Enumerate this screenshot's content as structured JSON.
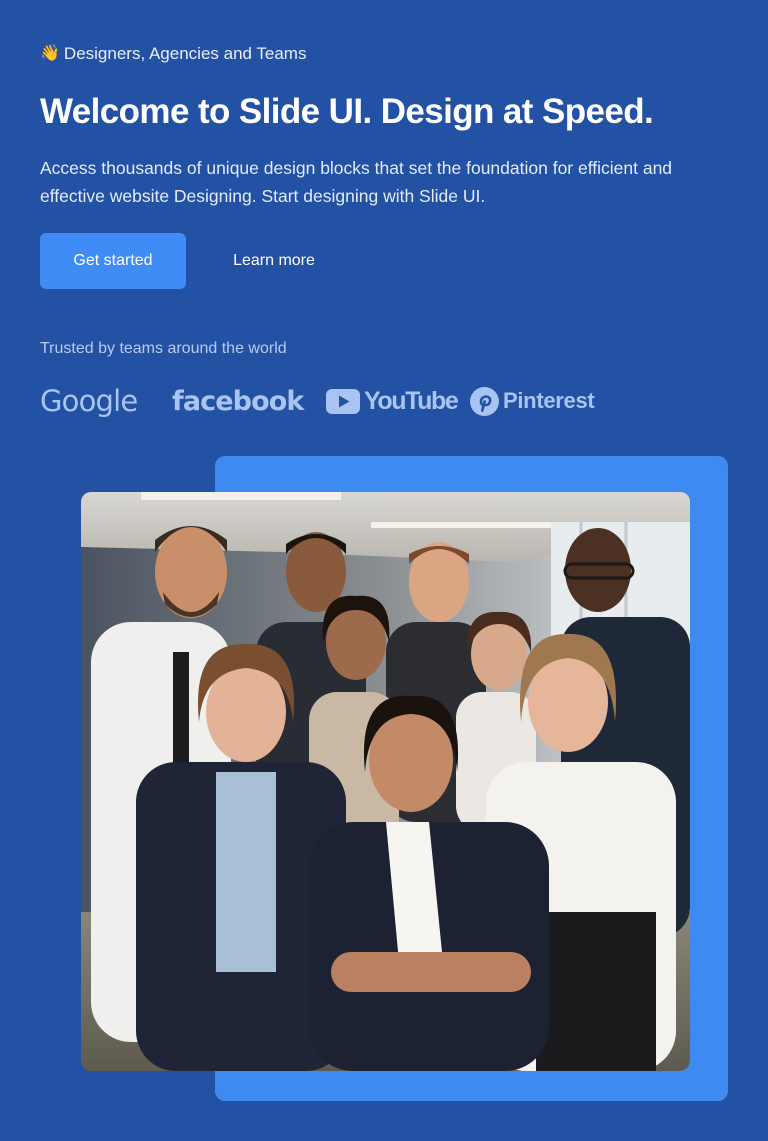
{
  "hero": {
    "eyebrow": {
      "emoji": "👋",
      "text": "Designers, Agencies and Teams"
    },
    "headline": "Welcome to Slide UI. Design at Speed.",
    "subtext": "Access thousands of unique design blocks that set the foundation for efficient and effective website Designing. Start designing with Slide UI.",
    "primary_button": "Get started",
    "secondary_button": "Learn more"
  },
  "trusted": {
    "label": "Trusted by teams around the world",
    "logos": [
      {
        "name": "Google",
        "icon": "google-logo"
      },
      {
        "name": "facebook",
        "icon": "facebook-logo"
      },
      {
        "name": "YouTube",
        "icon": "youtube-logo"
      },
      {
        "name": "Pinterest",
        "icon": "pinterest-logo"
      }
    ]
  },
  "colors": {
    "background": "#2351a3",
    "accent": "#3d8bf2",
    "primary_button": "#3f8cf6",
    "logo_tint": "#a9c4f2"
  },
  "image": {
    "icon": "team-photo"
  }
}
